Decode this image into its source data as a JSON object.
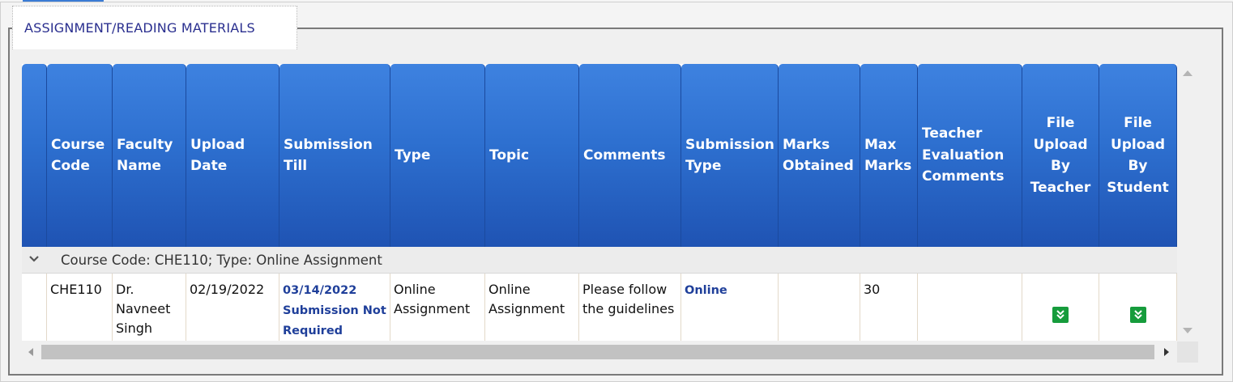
{
  "section": {
    "title": "ASSIGNMENT/READING MATERIALS"
  },
  "columns": [
    "Course Code",
    "Faculty Name",
    "Upload Date",
    "Submission Till",
    "Type",
    "Topic",
    "Comments",
    "Submission Type",
    "Marks Obtained",
    "Max Marks",
    "Teacher Evaluation Comments",
    "File Upload By Teacher",
    "File Upload By Student"
  ],
  "group": {
    "label": "Course Code: CHE110; Type: Online Assignment",
    "state_icon": "chevron-down-icon"
  },
  "rows": [
    {
      "course_code": "CHE110",
      "faculty_name": "Dr. Navneet Singh",
      "upload_date": "02/19/2022",
      "submission_till_date": "03/14/2022",
      "submission_till_note": "Submission Not Required",
      "type": "Online Assignment",
      "topic": "Online Assignment",
      "comments": "Please follow the guidelines",
      "submission_type": "Online",
      "marks_obtained": "",
      "max_marks": "30",
      "teacher_eval_comments": "",
      "file_teacher_icon": "download-icon",
      "file_student_icon": "download-icon"
    }
  ],
  "colors": {
    "header_top": "#3e82e0",
    "header_bottom": "#1f53b3",
    "link": "#1f3f9a",
    "download_icon": "#169c3c",
    "legend_text": "#2a2f8f"
  }
}
